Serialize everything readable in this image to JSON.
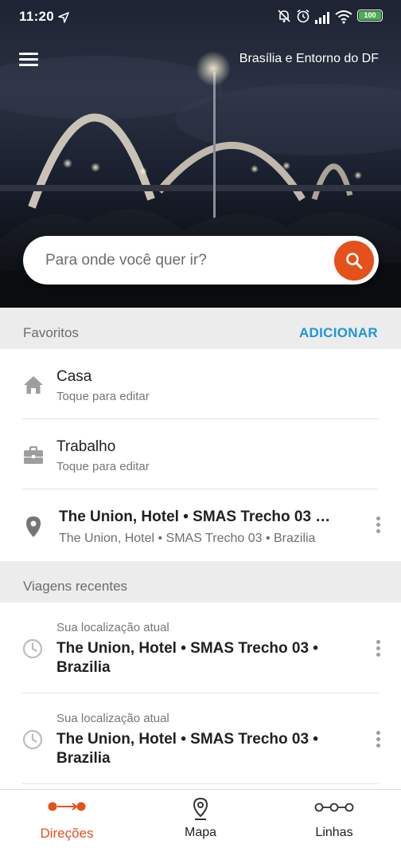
{
  "status_bar": {
    "time": "11:20",
    "battery_level": "100",
    "icons": [
      "location-arrow-icon",
      "notifications-off-icon",
      "alarm-icon",
      "signal-icon",
      "wifi-icon",
      "battery-icon"
    ]
  },
  "header": {
    "menu_icon": "hamburger-menu-icon",
    "region": "Brasília e Entorno do DF"
  },
  "search": {
    "placeholder": "Para onde você quer ir?",
    "button_icon": "search-icon",
    "accent": "#e5501b"
  },
  "favorites": {
    "title": "Favoritos",
    "add_label": "ADICIONAR",
    "items": [
      {
        "icon": "home-icon",
        "title": "Casa",
        "subtitle": "Toque para editar"
      },
      {
        "icon": "briefcase-icon",
        "title": "Trabalho",
        "subtitle": "Toque para editar"
      },
      {
        "icon": "place-pin-icon",
        "title": "The Union, Hotel • SMAS Trecho 03 …",
        "subtitle": "The Union, Hotel • SMAS Trecho 03 • Brazilia"
      }
    ]
  },
  "recent": {
    "title": "Viagens recentes",
    "items": [
      {
        "icon": "clock-icon",
        "origin": "Sua localização atual",
        "line1": "The Union, Hotel • SMAS Trecho 03 •",
        "line2": "Brazilia"
      },
      {
        "icon": "clock-icon",
        "origin": "Sua localização atual",
        "line1": "The Union, Hotel • SMAS Trecho 03 •",
        "line2": "Brazilia"
      }
    ]
  },
  "bottom_nav": {
    "items": [
      {
        "label": "Direções",
        "icon": "directions-icon",
        "active": true
      },
      {
        "label": "Mapa",
        "icon": "map-pin-icon",
        "active": false
      },
      {
        "label": "Linhas",
        "icon": "lines-icon",
        "active": false
      }
    ]
  },
  "colors": {
    "accent": "#e5501b",
    "link": "#1e96d6",
    "section_bg": "#ececec"
  }
}
